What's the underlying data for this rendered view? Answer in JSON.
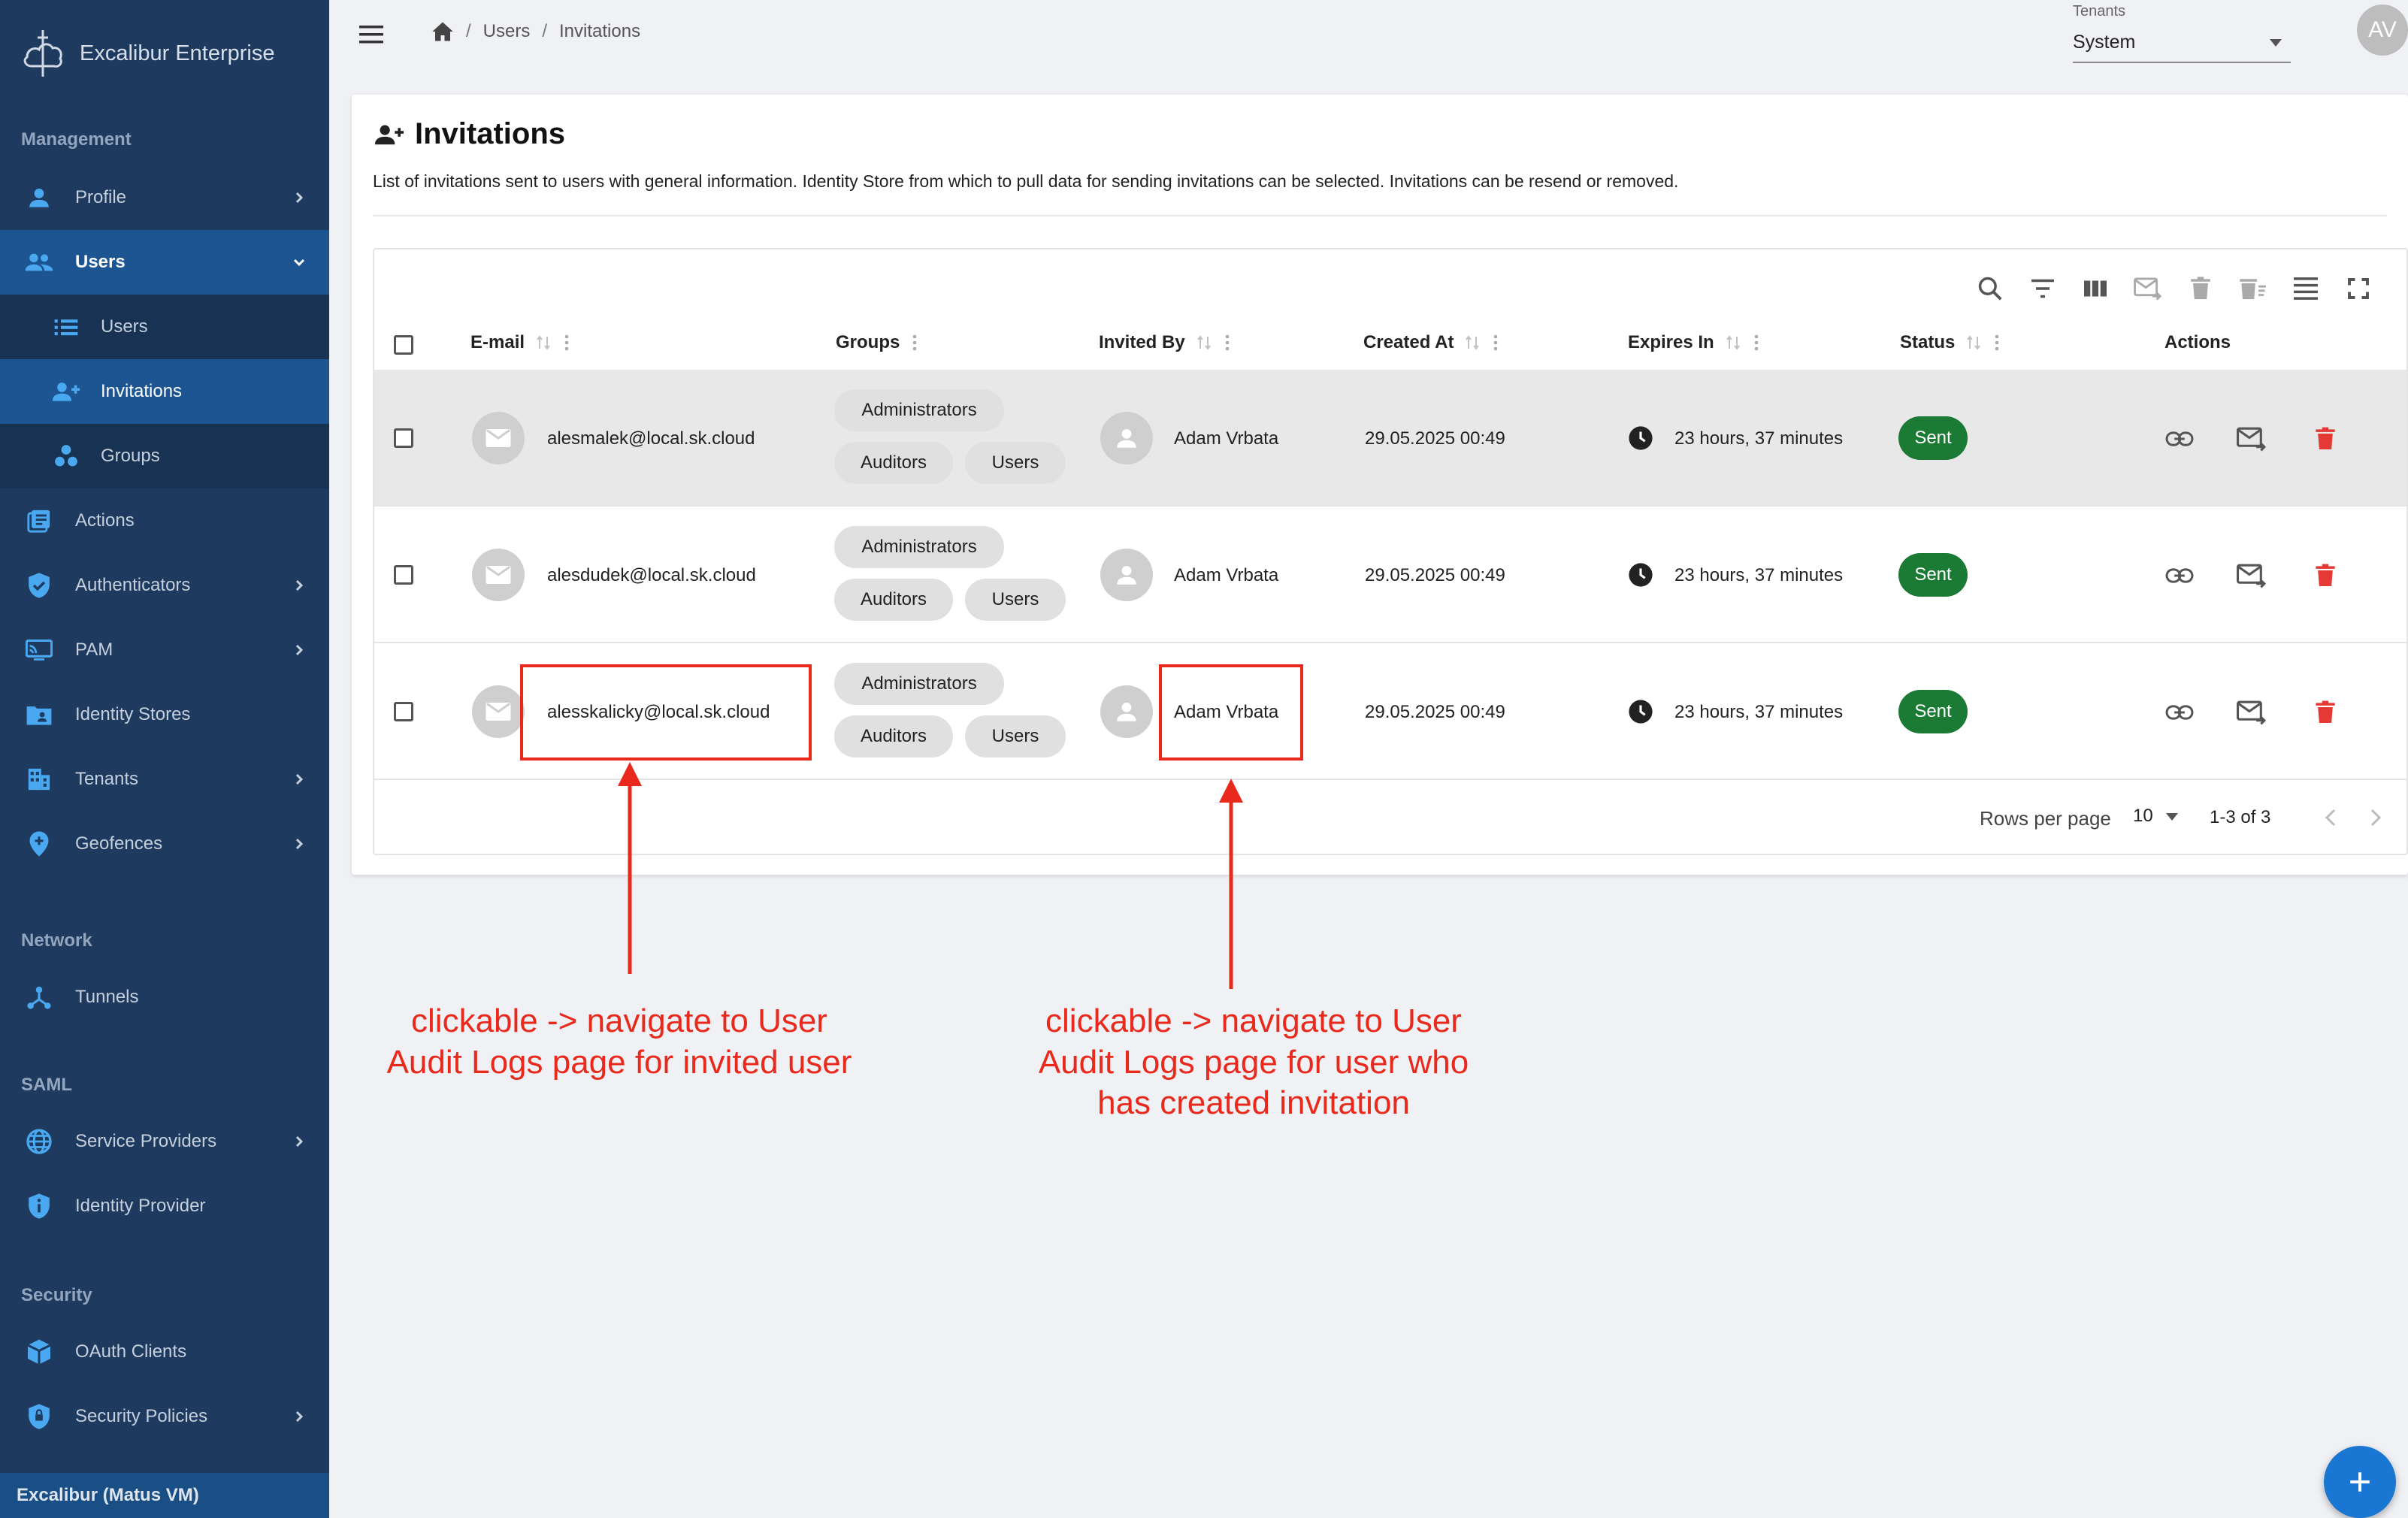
{
  "app": {
    "name": "Excalibur Enterprise",
    "footer": "Excalibur (Matus VM)"
  },
  "sidebar": {
    "sections": {
      "management": "Management",
      "network": "Network",
      "saml": "SAML",
      "security": "Security"
    },
    "items": [
      {
        "label": "Profile",
        "icon": "person-icon"
      },
      {
        "label": "Users",
        "icon": "users-icon"
      },
      {
        "label": "Users",
        "icon": "list-icon"
      },
      {
        "label": "Invitations",
        "icon": "person-add-icon"
      },
      {
        "label": "Groups",
        "icon": "groups-icon"
      },
      {
        "label": "Actions",
        "icon": "actions-icon"
      },
      {
        "label": "Authenticators",
        "icon": "shield-check-icon"
      },
      {
        "label": "PAM",
        "icon": "monitor-icon"
      },
      {
        "label": "Identity Stores",
        "icon": "folder-person-icon"
      },
      {
        "label": "Tenants",
        "icon": "building-icon"
      },
      {
        "label": "Geofences",
        "icon": "pin-icon"
      },
      {
        "label": "Tunnels",
        "icon": "tunnel-icon"
      },
      {
        "label": "Service Providers",
        "icon": "globe-icon"
      },
      {
        "label": "Identity Provider",
        "icon": "shield-info-icon"
      },
      {
        "label": "OAuth Clients",
        "icon": "cube-icon"
      },
      {
        "label": "Security Policies",
        "icon": "shield-lock-icon"
      }
    ]
  },
  "topbar": {
    "breadcrumb": [
      "Users",
      "Invitations"
    ],
    "tenant_label": "Tenants",
    "tenant_value": "System",
    "avatar_initials": "AV"
  },
  "page": {
    "title": "Invitations",
    "description": "List of invitations sent to users with general information. Identity Store from which to pull data for sending invitations can be selected. Invitations can be resend or removed."
  },
  "table": {
    "columns": {
      "email": "E-mail",
      "groups": "Groups",
      "invited_by": "Invited By",
      "created_at": "Created At",
      "expires_in": "Expires In",
      "status": "Status",
      "actions": "Actions"
    },
    "rows": [
      {
        "email": "alesmalek@local.sk.cloud",
        "groups": [
          "Administrators",
          "Auditors",
          "Users"
        ],
        "invited_by": "Adam Vrbata",
        "created_at": "29.05.2025 00:49",
        "expires_in": "23 hours, 37 minutes",
        "status": "Sent"
      },
      {
        "email": "alesdudek@local.sk.cloud",
        "groups": [
          "Administrators",
          "Auditors",
          "Users"
        ],
        "invited_by": "Adam Vrbata",
        "created_at": "29.05.2025 00:49",
        "expires_in": "23 hours, 37 minutes",
        "status": "Sent"
      },
      {
        "email": "alesskalicky@local.sk.cloud",
        "groups": [
          "Administrators",
          "Auditors",
          "Users"
        ],
        "invited_by": "Adam Vrbata",
        "created_at": "29.05.2025 00:49",
        "expires_in": "23 hours, 37 minutes",
        "status": "Sent"
      }
    ],
    "footer": {
      "rows_per_page_label": "Rows per page",
      "rows_per_page_value": "10",
      "range": "1-3 of 3"
    }
  },
  "annotations": {
    "left": "clickable -> navigate to User Audit Logs page for invited user",
    "right": "clickable -> navigate to User Audit Logs page for user who has created invitation"
  },
  "colors": {
    "sidebar_bg": "#1e3a5f",
    "sidebar_active": "#1c5591",
    "status_sent": "#1b7a34",
    "delete_red": "#e53935",
    "annotation_red": "#e8291c",
    "fab_blue": "#1976d2"
  }
}
